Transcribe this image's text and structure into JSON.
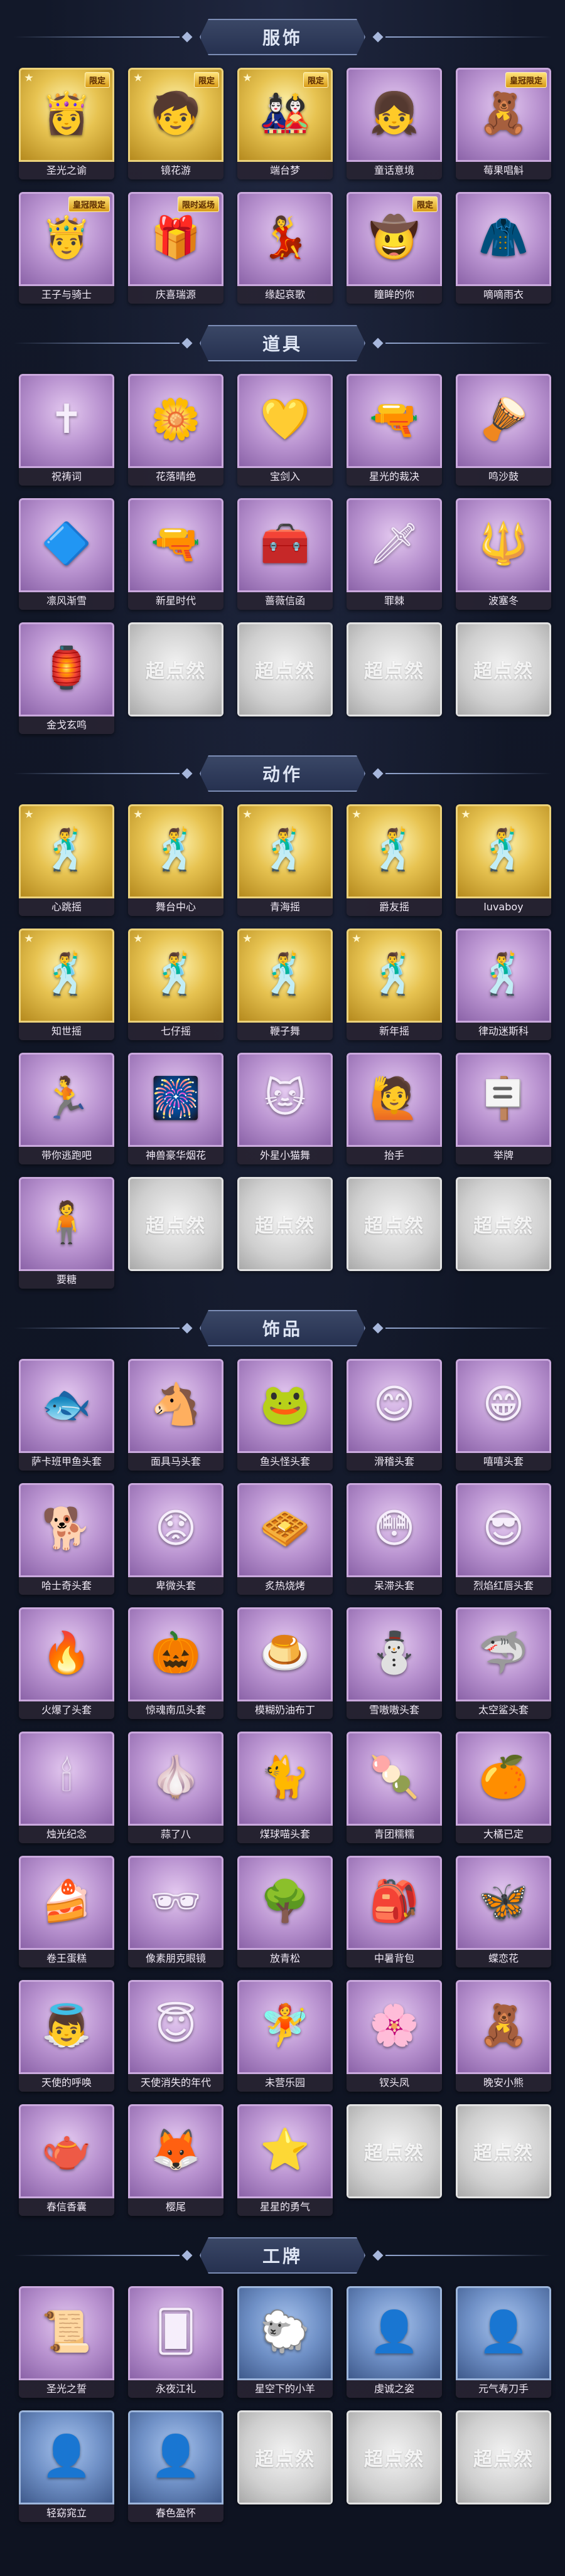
{
  "sections": [
    {
      "title": "服饰",
      "items": [
        {
          "label": "圣光之谕",
          "badge": "限定",
          "style": "gold",
          "icon": "👸"
        },
        {
          "label": "镜花游",
          "badge": "限定",
          "style": "gold",
          "icon": "🧒"
        },
        {
          "label": "端台梦",
          "badge": "限定",
          "style": "gold",
          "icon": "🎎"
        },
        {
          "label": "童话意境",
          "badge": "",
          "style": "purple",
          "icon": "👧"
        },
        {
          "label": "莓果唱斛",
          "badge": "皇冠限定",
          "style": "purple",
          "icon": "🧸"
        },
        {
          "label": "王子与骑士",
          "badge": "皇冠限定",
          "style": "purple",
          "icon": "🤴"
        },
        {
          "label": "庆喜瑞源",
          "badge": "限时返场",
          "style": "purple",
          "icon": "🎁"
        },
        {
          "label": "缘起哀歌",
          "badge": "",
          "style": "purple",
          "icon": "💃"
        },
        {
          "label": "瞳眸的你",
          "badge": "限定",
          "style": "purple",
          "icon": "🤠"
        },
        {
          "label": "嘀嘀雨衣",
          "badge": "",
          "style": "purple",
          "icon": "🧥"
        }
      ]
    },
    {
      "title": "道具",
      "items": [
        {
          "label": "祝祷词",
          "badge": "",
          "style": "purple",
          "icon": "✝"
        },
        {
          "label": "花落晴绝",
          "badge": "",
          "style": "purple",
          "icon": "🌼"
        },
        {
          "label": "宝剑入",
          "badge": "",
          "style": "purple",
          "icon": "💛"
        },
        {
          "label": "星光的裁决",
          "badge": "",
          "style": "purple",
          "icon": "🔫"
        },
        {
          "label": "鸣沙鼓",
          "badge": "",
          "style": "purple",
          "icon": "🪘"
        },
        {
          "label": "凛风渐雪",
          "badge": "",
          "style": "purple",
          "icon": "🔷"
        },
        {
          "label": "新星时代",
          "badge": "",
          "style": "purple",
          "icon": "🔫"
        },
        {
          "label": "蔷薇信函",
          "badge": "",
          "style": "purple",
          "icon": "🧰"
        },
        {
          "label": "罪棘",
          "badge": "",
          "style": "purple",
          "icon": "🗡"
        },
        {
          "label": "波塞冬",
          "badge": "",
          "style": "purple",
          "icon": "🔱"
        },
        {
          "label": "金戈玄鸣",
          "badge": "",
          "style": "purple",
          "icon": "🏮"
        },
        {
          "label": "",
          "badge": "",
          "style": "empty",
          "watermark": "超点然"
        },
        {
          "label": "",
          "badge": "",
          "style": "empty",
          "watermark": "超点然"
        },
        {
          "label": "",
          "badge": "",
          "style": "empty",
          "watermark": "超点然"
        },
        {
          "label": "",
          "badge": "",
          "style": "empty",
          "watermark": "超点然"
        }
      ]
    },
    {
      "title": "动作",
      "items": [
        {
          "label": "心跳摇",
          "badge": "",
          "style": "gold",
          "icon": "🕺"
        },
        {
          "label": "舞台中心",
          "badge": "",
          "style": "gold",
          "icon": "🕺"
        },
        {
          "label": "青海摇",
          "badge": "",
          "style": "gold",
          "icon": "🕺"
        },
        {
          "label": "爵友摇",
          "badge": "",
          "style": "gold",
          "icon": "🕺"
        },
        {
          "label": "luvaboy",
          "badge": "",
          "style": "gold",
          "icon": "🕺"
        },
        {
          "label": "知世摇",
          "badge": "",
          "style": "gold",
          "icon": "🕺"
        },
        {
          "label": "七仔摇",
          "badge": "",
          "style": "gold",
          "icon": "🕺"
        },
        {
          "label": "鞭子舞",
          "badge": "",
          "style": "gold",
          "icon": "🕺"
        },
        {
          "label": "新年摇",
          "badge": "",
          "style": "gold",
          "icon": "🕺"
        },
        {
          "label": "律动迷斯科",
          "badge": "",
          "style": "purple",
          "icon": "🕺"
        },
        {
          "label": "带你逃跑吧",
          "badge": "",
          "style": "purple",
          "icon": "🏃"
        },
        {
          "label": "神兽豪华烟花",
          "badge": "",
          "style": "purple",
          "icon": "🎆"
        },
        {
          "label": "外星小猫舞",
          "badge": "",
          "style": "purple",
          "icon": "🐱"
        },
        {
          "label": "抬手",
          "badge": "",
          "style": "purple",
          "icon": "🙋"
        },
        {
          "label": "举牌",
          "badge": "",
          "style": "purple",
          "icon": "🪧"
        },
        {
          "label": "要糖",
          "badge": "",
          "style": "purple",
          "icon": "🧍"
        },
        {
          "label": "",
          "badge": "",
          "style": "empty",
          "watermark": "超点然"
        },
        {
          "label": "",
          "badge": "",
          "style": "empty",
          "watermark": "超点然"
        },
        {
          "label": "",
          "badge": "",
          "style": "empty",
          "watermark": "超点然"
        },
        {
          "label": "",
          "badge": "",
          "style": "empty",
          "watermark": "超点然"
        }
      ]
    },
    {
      "title": "饰品",
      "items": [
        {
          "label": "萨卡班甲鱼头套",
          "badge": "",
          "style": "purple",
          "icon": "🐟"
        },
        {
          "label": "面具马头套",
          "badge": "",
          "style": "purple",
          "icon": "🐴"
        },
        {
          "label": "鱼头怪头套",
          "badge": "",
          "style": "purple",
          "icon": "🐸"
        },
        {
          "label": "滑稽头套",
          "badge": "",
          "style": "purple",
          "icon": "😊"
        },
        {
          "label": "嘻嘻头套",
          "badge": "",
          "style": "purple",
          "icon": "😁"
        },
        {
          "label": "哈士奇头套",
          "badge": "",
          "style": "purple",
          "icon": "🐕"
        },
        {
          "label": "卑微头套",
          "badge": "",
          "style": "purple",
          "icon": "😟"
        },
        {
          "label": "炙热烧烤",
          "badge": "",
          "style": "purple",
          "icon": "🧇"
        },
        {
          "label": "呆滞头套",
          "badge": "",
          "style": "purple",
          "icon": "😳"
        },
        {
          "label": "烈焰红唇头套",
          "badge": "",
          "style": "purple",
          "icon": "😎"
        },
        {
          "label": "火爆了头套",
          "badge": "",
          "style": "purple",
          "icon": "🔥"
        },
        {
          "label": "惊魂南瓜头套",
          "badge": "",
          "style": "purple",
          "icon": "🎃"
        },
        {
          "label": "模糊奶油布丁",
          "badge": "",
          "style": "purple",
          "icon": "🍮"
        },
        {
          "label": "雪嗷嗷头套",
          "badge": "",
          "style": "purple",
          "icon": "⛄"
        },
        {
          "label": "太空鲨头套",
          "badge": "",
          "style": "purple",
          "icon": "🦈"
        },
        {
          "label": "烛光纪念",
          "badge": "",
          "style": "purple",
          "icon": "🕯"
        },
        {
          "label": "蒜了八",
          "badge": "",
          "style": "purple",
          "icon": "🧄"
        },
        {
          "label": "煤球喵头套",
          "badge": "",
          "style": "purple",
          "icon": "🐈"
        },
        {
          "label": "青团糯糯",
          "badge": "",
          "style": "purple",
          "icon": "🍡"
        },
        {
          "label": "大橘已定",
          "badge": "",
          "style": "purple",
          "icon": "🍊"
        },
        {
          "label": "卷王蛋糕",
          "badge": "",
          "style": "purple",
          "icon": "🍰"
        },
        {
          "label": "像素朋克眼镜",
          "badge": "",
          "style": "purple",
          "icon": "🕶"
        },
        {
          "label": "放青松",
          "badge": "",
          "style": "purple",
          "icon": "🌳"
        },
        {
          "label": "中暑背包",
          "badge": "",
          "style": "purple",
          "icon": "🎒"
        },
        {
          "label": "蝶恋花",
          "badge": "",
          "style": "purple",
          "icon": "🦋"
        },
        {
          "label": "天使的呼唤",
          "badge": "",
          "style": "purple",
          "icon": "👼"
        },
        {
          "label": "天使消失的年代",
          "badge": "",
          "style": "purple",
          "icon": "😇"
        },
        {
          "label": "未营乐园",
          "badge": "",
          "style": "purple",
          "icon": "🧚"
        },
        {
          "label": "钗头凤",
          "badge": "",
          "style": "purple",
          "icon": "🌸"
        },
        {
          "label": "晚安小熊",
          "badge": "",
          "style": "purple",
          "icon": "🧸"
        },
        {
          "label": "春信香囊",
          "badge": "",
          "style": "purple",
          "icon": "🫖"
        },
        {
          "label": "樱尾",
          "badge": "",
          "style": "purple",
          "icon": "🦊"
        },
        {
          "label": "星星的勇气",
          "badge": "",
          "style": "purple",
          "icon": "⭐"
        },
        {
          "label": "",
          "badge": "",
          "style": "empty",
          "watermark": "超点然"
        },
        {
          "label": "",
          "badge": "",
          "style": "empty",
          "watermark": "超点然"
        }
      ]
    },
    {
      "title": "工牌",
      "items": [
        {
          "label": "圣光之誓",
          "badge": "",
          "style": "purple",
          "icon": "📜"
        },
        {
          "label": "永夜江礼",
          "badge": "",
          "style": "purple",
          "icon": "🂠"
        },
        {
          "label": "星空下的小羊",
          "badge": "",
          "style": "blue",
          "icon": "🐑"
        },
        {
          "label": "虔诚之姿",
          "badge": "",
          "style": "blue",
          "icon": "👤"
        },
        {
          "label": "元气寿刀手",
          "badge": "",
          "style": "blue",
          "icon": "👤"
        },
        {
          "label": "轻窈窕立",
          "badge": "",
          "style": "blue",
          "icon": "👤"
        },
        {
          "label": "春色盈怀",
          "badge": "",
          "style": "blue",
          "icon": "👤"
        },
        {
          "label": "",
          "badge": "",
          "style": "empty",
          "watermark": "超点然"
        },
        {
          "label": "",
          "badge": "",
          "style": "empty",
          "watermark": "超点然"
        },
        {
          "label": "",
          "badge": "",
          "style": "empty",
          "watermark": "超点然"
        }
      ]
    }
  ]
}
